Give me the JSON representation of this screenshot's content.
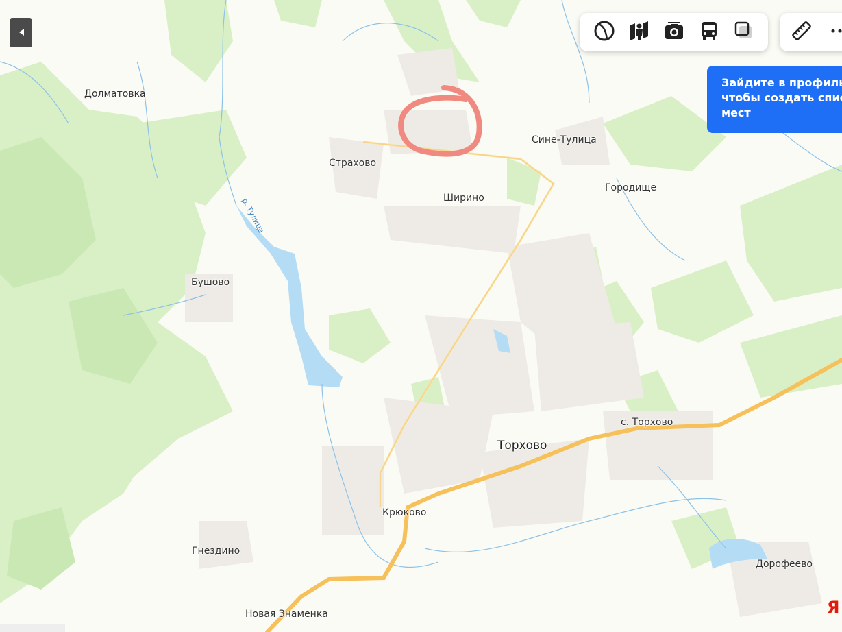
{
  "map": {
    "places": [
      {
        "id": "dolmatovka",
        "label": "Долматовка"
      },
      {
        "id": "strakhovo",
        "label": "Страхово"
      },
      {
        "id": "sine-tulitsa",
        "label": "Сине-Тулица"
      },
      {
        "id": "gorodishche",
        "label": "Городище"
      },
      {
        "id": "shirino",
        "label": "Ширино"
      },
      {
        "id": "bushovo",
        "label": "Бушово"
      },
      {
        "id": "torkhovo",
        "label": "Торхово"
      },
      {
        "id": "s-torkhovo",
        "label": "с. Торхово"
      },
      {
        "id": "kryukovo",
        "label": "Крюково"
      },
      {
        "id": "gnezdino",
        "label": "Гнездино"
      },
      {
        "id": "novaya-znamenka",
        "label": "Новая Знаменка"
      },
      {
        "id": "dorofeevo",
        "label": "Дорофеево"
      }
    ],
    "river_label": "р. Тулица",
    "annotation_color": "#f08a80"
  },
  "toolbar": {
    "buttons": [
      {
        "name": "layers-circle-icon"
      },
      {
        "name": "panorama-person-icon"
      },
      {
        "name": "camera-icon"
      },
      {
        "name": "bus-icon"
      },
      {
        "name": "map-layers-icon"
      }
    ],
    "secondary": [
      {
        "name": "ruler-icon"
      },
      {
        "name": "more-dots-icon"
      }
    ]
  },
  "promo": {
    "text": "Зайдите в профиль, чтобы создать список мест"
  },
  "brand": {
    "logo_text": "Я"
  },
  "colors": {
    "land": "#fbfbf5",
    "forest": "#d7efc5",
    "forest_dark": "#c4e6ae",
    "water": "#b5dcf5",
    "road_main": "#f6c15a",
    "road_minor": "#fbe3a0",
    "settlement": "#efece8",
    "accent_blue": "#1e6ff5"
  }
}
